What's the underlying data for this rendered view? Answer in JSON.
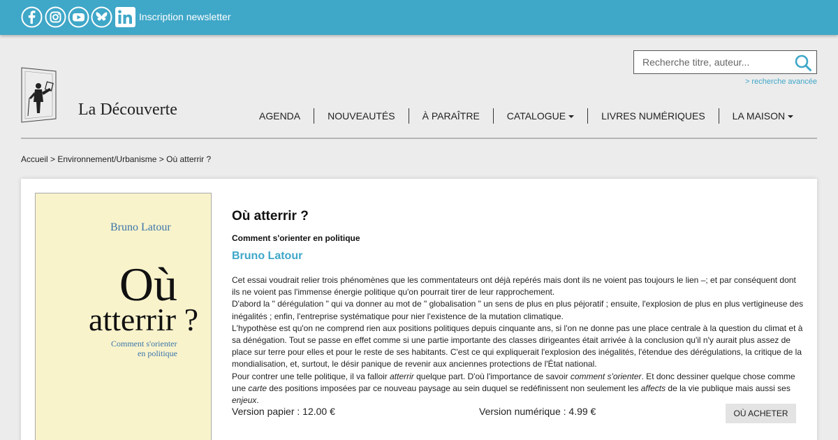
{
  "topbar": {
    "social": [
      {
        "icon": "facebook-icon"
      },
      {
        "icon": "instagram-icon"
      },
      {
        "icon": "youtube-icon"
      },
      {
        "icon": "bluesky-icon"
      },
      {
        "icon": "linkedin-icon"
      }
    ],
    "newsletter": "Inscription newsletter",
    "color": "#3fa7c8"
  },
  "header": {
    "logo_text": "La Découverte",
    "search_placeholder": "Recherche titre, auteur...",
    "advanced_search": "> recherche avancée"
  },
  "nav": {
    "items": [
      {
        "label": "AGENDA"
      },
      {
        "label": "NOUVEAUTÉS"
      },
      {
        "label": "À PARAÎTRE"
      },
      {
        "label": "CATALOGUE",
        "dropdown": true
      },
      {
        "label": "LIVRES NUMÉRIQUES"
      },
      {
        "label": "LA MAISON",
        "dropdown": true
      }
    ]
  },
  "breadcrumb": {
    "home": "Accueil",
    "sep1": " > ",
    "category": "Environnement/Urbanisme",
    "sep2": " > ",
    "current": "Où atterrir ?"
  },
  "cover": {
    "author": "Bruno Latour",
    "title_line1": "Où",
    "title_line2": "atterrir ?",
    "subtitle_line1": "Comment s'orienter",
    "subtitle_line2": "en politique"
  },
  "book": {
    "title": "Où atterrir ?",
    "subtitle": "Comment s'orienter en politique",
    "author": "Bruno Latour",
    "description": {
      "p1": "Cet essai voudrait relier trois phénomènes que les commentateurs ont déjà repérés mais dont ils ne voient pas toujours le lien –; et par conséquent dont ils ne voient pas l'immense énergie politique qu'on pourrait tirer de leur rapprochement.",
      "p2": "D'abord la \" dérégulation \" qui va donner au mot de \" globalisation \" un sens de plus en plus péjoratif ; ensuite, l'explosion de plus en plus vertigineuse des inégalités ; enfin, l'entreprise systématique pour nier l'existence de la mutation climatique.",
      "p3": "L'hypothèse est qu'on ne comprend rien aux positions politiques depuis cinquante ans, si l'on ne donne pas une place centrale à la question du climat et à sa dénégation. Tout se passe en effet comme si une partie importante des classes dirigeantes était arrivée à la conclusion qu'il n'y aurait plus assez de place sur terre pour elles et pour le reste de ses habitants. C'est ce qui expliquerait l'explosion des inégalités, l'étendue des dérégulations, la critique de la mondialisation, et, surtout, le désir panique de revenir aux anciennes protections de l'État national.",
      "p4_a": "Pour contrer une telle politique, il va falloir ",
      "p4_b": "atterrir",
      "p4_c": " quelque part. D'où l'importance de savoir ",
      "p4_d": "comment s'orienter",
      "p4_e": ". Et donc dessiner quelque chose comme une ",
      "p4_f": "carte",
      "p4_g": " des positions imposées par ce nouveau paysage au sein duquel se redéfinissent non seulement les ",
      "p4_h": "affects",
      "p4_i": " de la vie publique mais aussi ses ",
      "p4_j": "enjeux",
      "p4_k": "."
    },
    "price_paper": "Version papier : 12.00 €",
    "price_digital": "Version numérique : 4.99 €",
    "buy_label": "OÙ ACHETER"
  }
}
